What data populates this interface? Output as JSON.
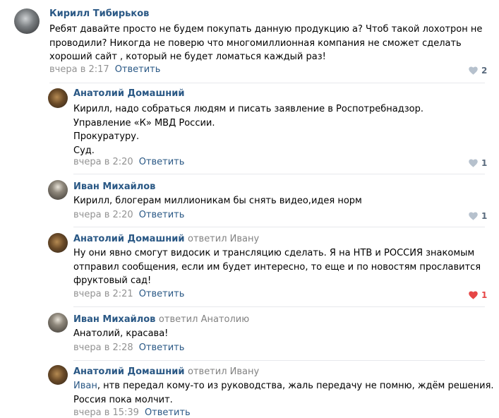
{
  "comments": [
    {
      "author": "Кирилл Тибирьков",
      "reply_to": "",
      "lines": [
        "Ребят давайте просто не будем покупать данную продукцию а? Чтоб такой лохотрон не",
        "проводили? Никогда не поверю что многомиллионная компания не сможет сделать",
        "хороший сайт , который не будет ломаться каждый раз!"
      ],
      "time": "вчера в 2:17",
      "reply_label": "Ответить",
      "likes": "2",
      "liked": false
    },
    {
      "author": "Анатолий Домашний",
      "reply_to": "",
      "lines": [
        "Кирилл, надо собраться людям и писать заявление в Роспотребнадзор.",
        "Управление «К» МВД России.",
        "Прокуратуру.",
        "Суд."
      ],
      "time": "вчера в 2:20",
      "reply_label": "Ответить",
      "likes": "1",
      "liked": false
    },
    {
      "author": "Иван Михайлов",
      "reply_to": "",
      "lines": [
        "Кирилл, блогерам миллионикам бы снять видео,идея норм"
      ],
      "time": "вчера в 2:20",
      "reply_label": "Ответить",
      "likes": "1",
      "liked": false
    },
    {
      "author": "Анатолий Домашний",
      "reply_to": "ответил Ивану",
      "lines": [
        "Ну они явно смогут видосик и трансляцию сделать. Я на НТВ и РОССИЯ знакомым",
        "отправил сообщения, если им будет интересно, то еще и по новостям прославится",
        "фруктовый сад!"
      ],
      "time": "вчера в 2:21",
      "reply_label": "Ответить",
      "likes": "1",
      "liked": true
    },
    {
      "author": "Иван Михайлов",
      "reply_to": "ответил Анатолию",
      "lines": [
        "Анатолий, красава!"
      ],
      "time": "вчера в 2:28",
      "reply_label": "Ответить",
      "likes": "",
      "liked": false
    },
    {
      "author": "Анатолий Домашний",
      "reply_to": "ответил Ивану",
      "mention": "Иван",
      "lines": [
        ", нтв передал кому-то из руководства, жаль передачу не помню, ждём решения.",
        "Россия пока молчит."
      ],
      "time": "вчера в 15:39",
      "reply_label": "Ответить",
      "likes": "",
      "liked": false
    }
  ],
  "colors": {
    "link": "#2a5885",
    "meta": "#939393",
    "like_active": "#e64646",
    "like_inactive": "#b6c1cd",
    "divider": "#e7e8ec"
  }
}
